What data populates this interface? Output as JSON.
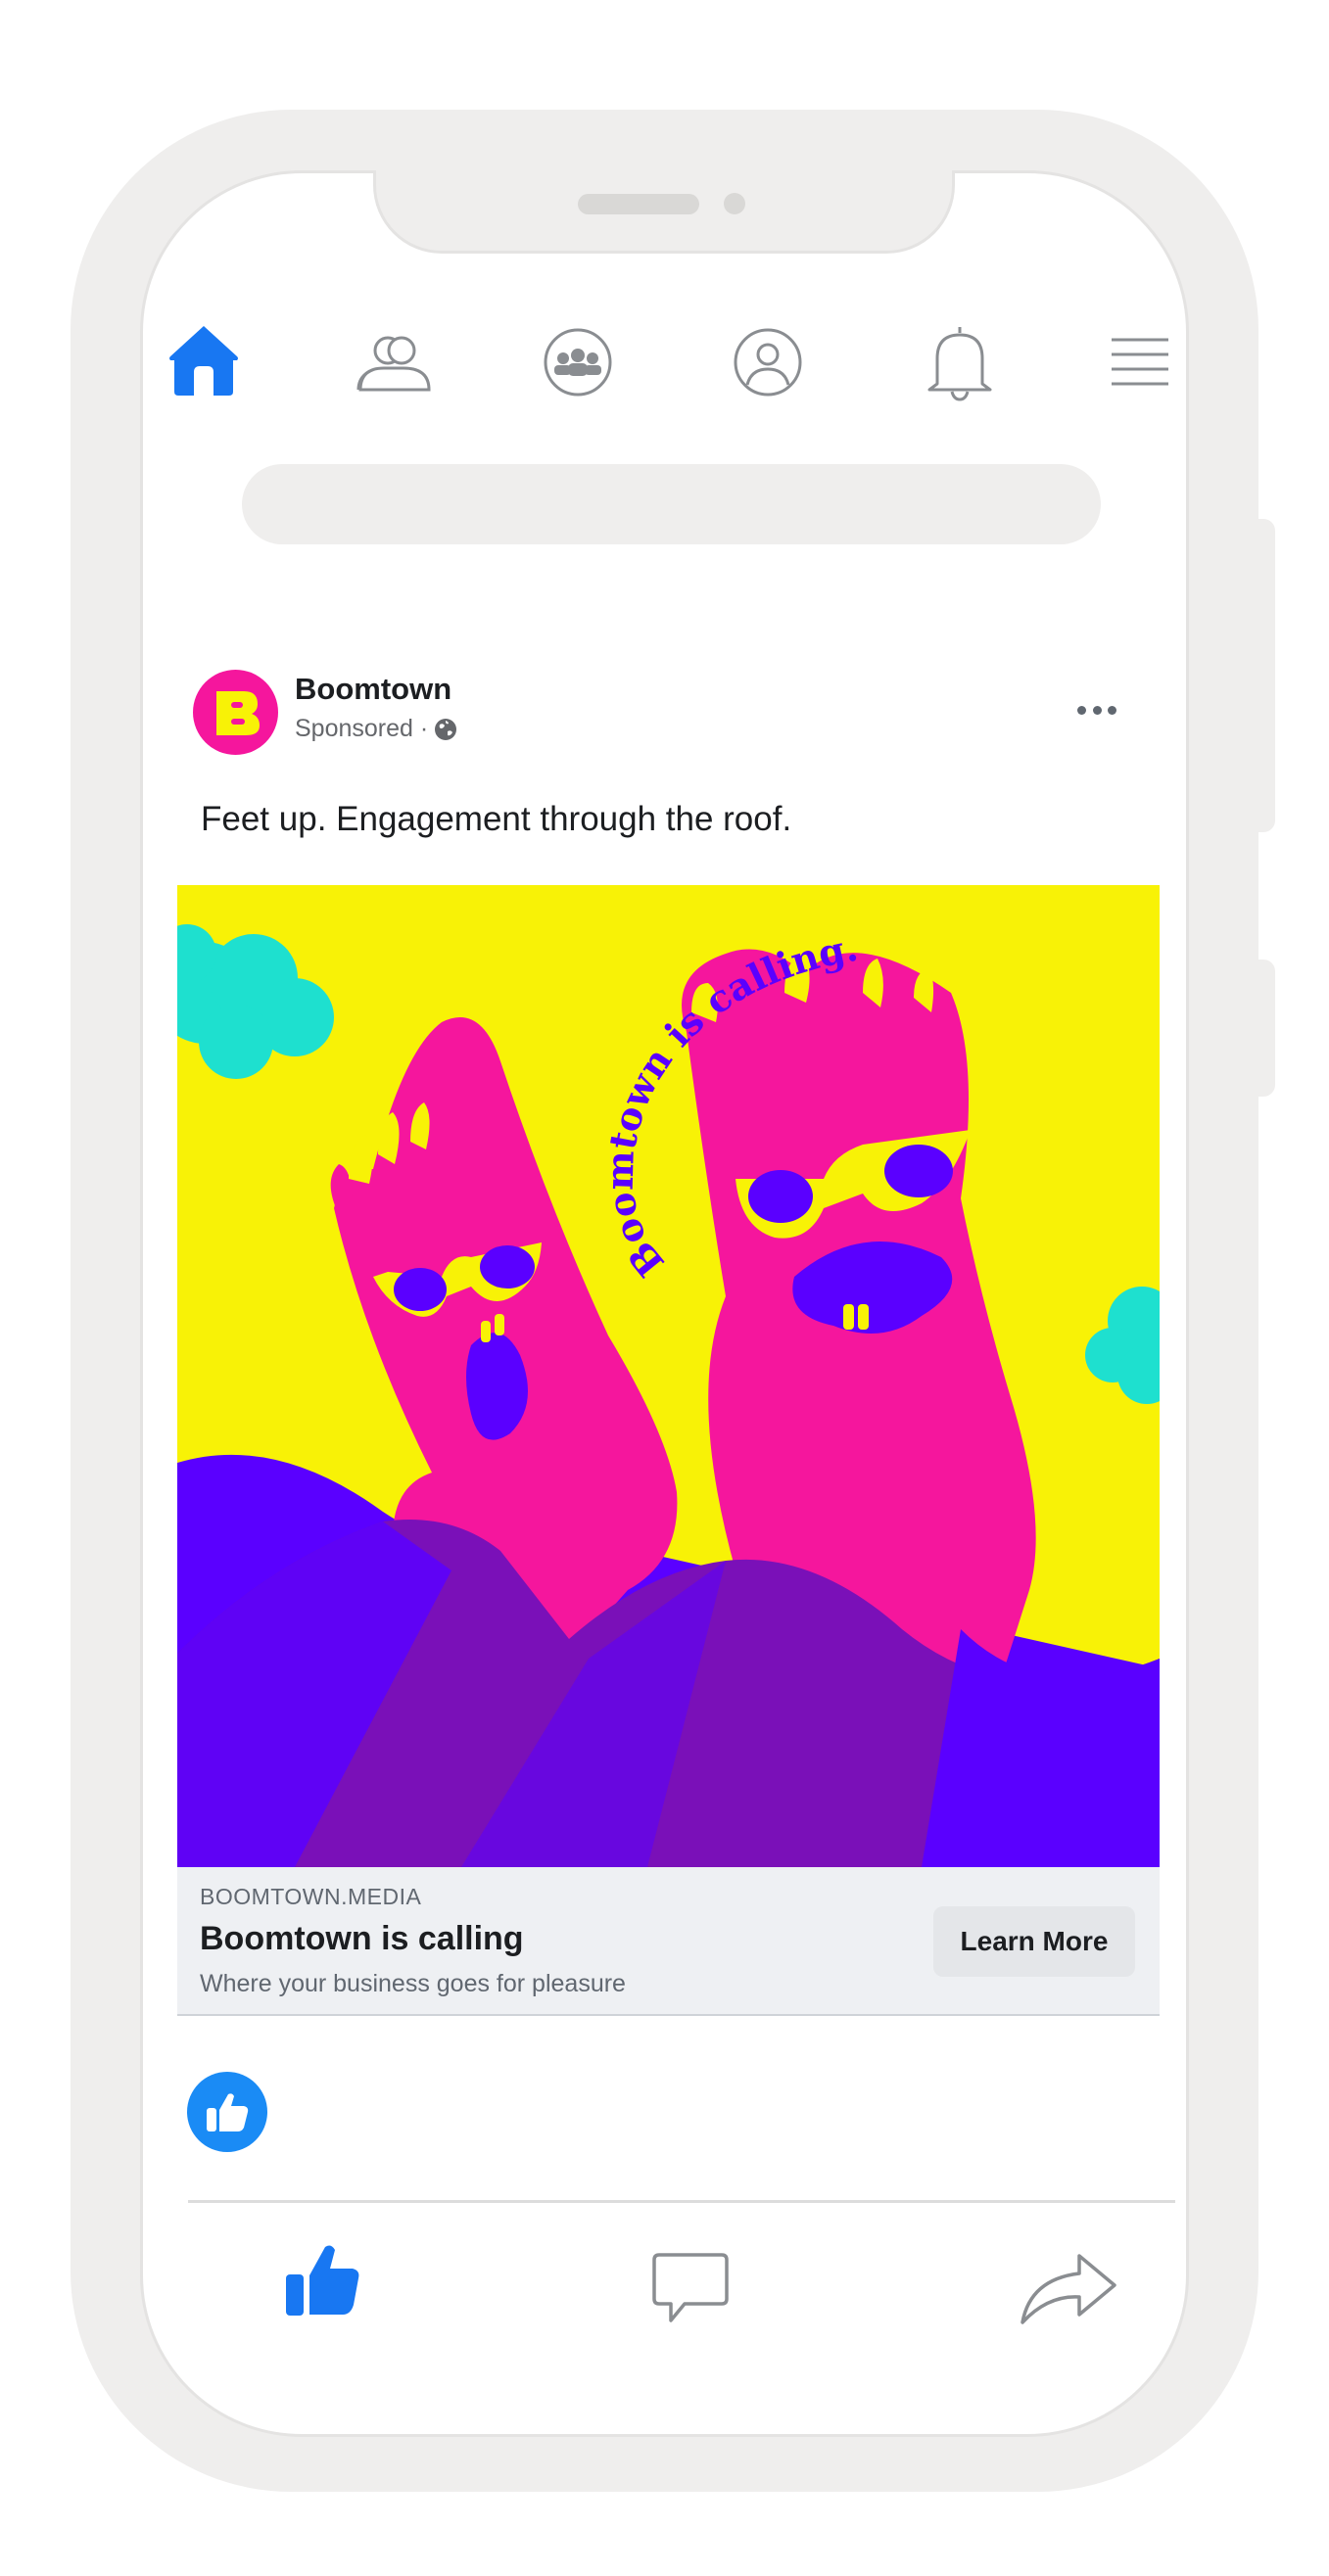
{
  "nav": {
    "items": [
      {
        "icon": "home-icon",
        "active": true
      },
      {
        "icon": "friends-icon",
        "active": false
      },
      {
        "icon": "groups-icon",
        "active": false
      },
      {
        "icon": "profile-icon",
        "active": false
      },
      {
        "icon": "bell-icon",
        "active": false
      },
      {
        "icon": "menu-icon",
        "active": false
      }
    ]
  },
  "search": {
    "placeholder": ""
  },
  "post": {
    "author": "Boomtown",
    "avatar_letter": "B",
    "sponsored": "Sponsored ·",
    "text": "Feet up. Engagement through the roof.",
    "image": {
      "caption": "Boomtown is calling."
    },
    "link": {
      "domain": "BOOMTOWN.MEDIA",
      "headline": "Boomtown is calling",
      "description": "Where your business goes for pleasure",
      "cta": "Learn More"
    }
  },
  "actions": {
    "items": [
      "like-icon",
      "comment-icon",
      "share-icon"
    ]
  },
  "colors": {
    "accent_blue": "#1877f2",
    "brand_pink": "#f5169d",
    "brand_yellow": "#f8f206",
    "brand_purple": "#5a00ff",
    "cloud_teal": "#1ee0cf"
  }
}
